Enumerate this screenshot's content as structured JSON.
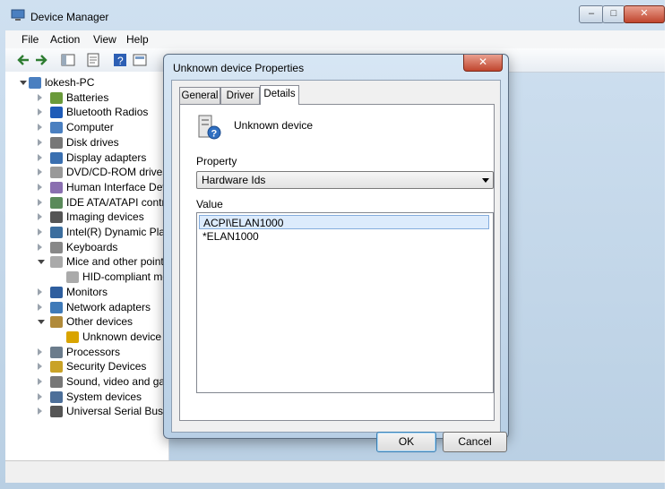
{
  "window": {
    "title": "Device Manager"
  },
  "caption_buttons": {
    "minimize": "–",
    "maximize": "□",
    "close": "✕"
  },
  "menu": [
    "File",
    "Action",
    "View",
    "Help"
  ],
  "toolbar_icons": [
    "back-icon",
    "forward-icon",
    "properties-icon",
    "console-tree-icon",
    "help-icon",
    "properties-sheet-icon"
  ],
  "tree": [
    {
      "label": "lokesh-PC",
      "state": "expanded",
      "icon": "computer-icon"
    },
    {
      "label": "Batteries",
      "state": "collapsed",
      "icon": "battery-icon"
    },
    {
      "label": "Bluetooth Radios",
      "state": "collapsed",
      "icon": "bluetooth-icon"
    },
    {
      "label": "Computer",
      "state": "collapsed",
      "icon": "computer-icon"
    },
    {
      "label": "Disk drives",
      "state": "collapsed",
      "icon": "disk-icon"
    },
    {
      "label": "Display adapters",
      "state": "collapsed",
      "icon": "display-icon"
    },
    {
      "label": "DVD/CD-ROM drives",
      "state": "collapsed",
      "icon": "dvd-icon"
    },
    {
      "label": "Human Interface Devic",
      "state": "collapsed",
      "icon": "hid-icon"
    },
    {
      "label": "IDE ATA/ATAPI contro",
      "state": "collapsed",
      "icon": "ide-icon"
    },
    {
      "label": "Imaging devices",
      "state": "collapsed",
      "icon": "camera-icon"
    },
    {
      "label": "Intel(R) Dynamic Platfo",
      "state": "collapsed",
      "icon": "chip-icon"
    },
    {
      "label": "Keyboards",
      "state": "collapsed",
      "icon": "keyboard-icon"
    },
    {
      "label": "Mice and other pointin",
      "state": "expanded",
      "icon": "mouse-icon"
    },
    {
      "label": "HID-compliant mo",
      "state": "child",
      "icon": "mouse-icon"
    },
    {
      "label": "Monitors",
      "state": "collapsed",
      "icon": "monitor-icon"
    },
    {
      "label": "Network adapters",
      "state": "collapsed",
      "icon": "network-icon"
    },
    {
      "label": "Other devices",
      "state": "expanded",
      "icon": "other-devices-icon"
    },
    {
      "label": "Unknown device",
      "state": "child",
      "icon": "warning-device-icon"
    },
    {
      "label": "Processors",
      "state": "collapsed",
      "icon": "processor-icon"
    },
    {
      "label": "Security Devices",
      "state": "collapsed",
      "icon": "key-icon"
    },
    {
      "label": "Sound, video and gam",
      "state": "collapsed",
      "icon": "speaker-icon"
    },
    {
      "label": "System devices",
      "state": "collapsed",
      "icon": "system-icon"
    },
    {
      "label": "Universal Serial Bus co",
      "state": "collapsed",
      "icon": "usb-icon"
    }
  ],
  "dialog": {
    "title": "Unknown device Properties",
    "close": "✕",
    "tabs": [
      "General",
      "Driver",
      "Details"
    ],
    "active_tab": "Details",
    "device_name": "Unknown device",
    "property_label": "Property",
    "property_value": "Hardware Ids",
    "value_label": "Value",
    "values": [
      "ACPI\\ELAN1000",
      "*ELAN1000"
    ],
    "ok": "OK",
    "cancel": "Cancel"
  }
}
